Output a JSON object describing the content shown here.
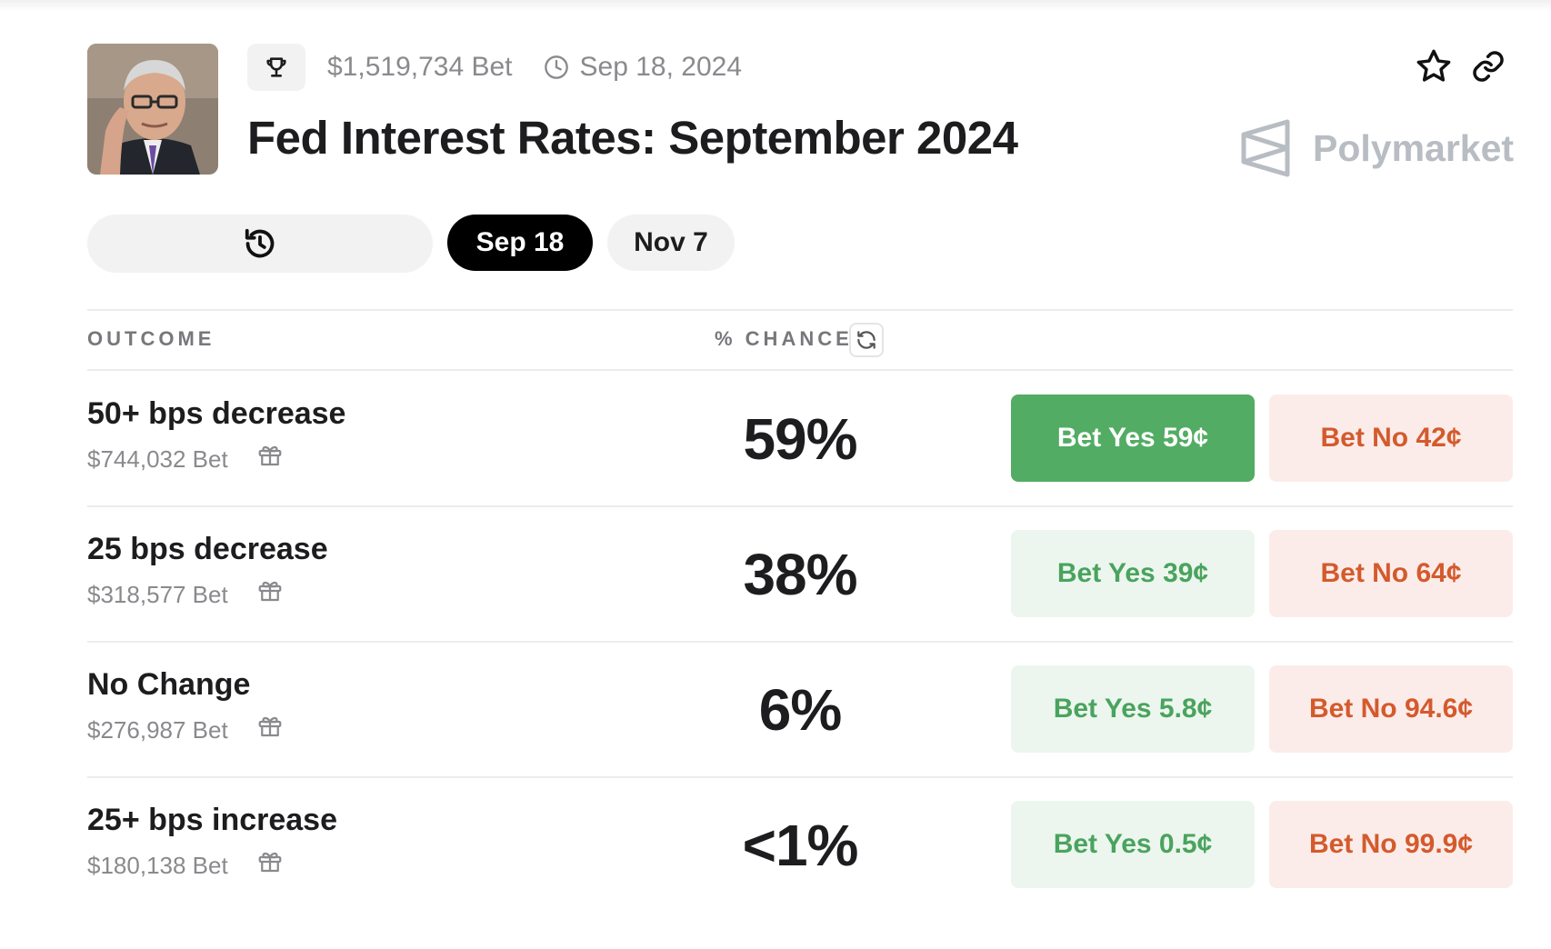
{
  "header": {
    "volume": "$1,519,734 Bet",
    "date": "Sep 18, 2024",
    "title": "Fed Interest Rates: September 2024",
    "brand": "Polymarket",
    "icons": [
      "trophy-icon",
      "clock-icon",
      "star-icon",
      "link-icon",
      "polymarket-logo-icon"
    ]
  },
  "date_tabs": {
    "history_icon": "history-icon",
    "tabs": [
      {
        "label": "Sep 18",
        "active": true
      },
      {
        "label": "Nov 7",
        "active": false
      }
    ]
  },
  "table": {
    "col_outcome": "OUTCOME",
    "col_chance": "% CHANCE",
    "rows": [
      {
        "name": "50+ bps decrease",
        "volume": "$744,032 Bet",
        "chance": "59%",
        "yes": "Bet Yes 59¢",
        "no": "Bet No 42¢",
        "yes_active": true
      },
      {
        "name": "25 bps decrease",
        "volume": "$318,577 Bet",
        "chance": "38%",
        "yes": "Bet Yes 39¢",
        "no": "Bet No 64¢",
        "yes_active": false
      },
      {
        "name": "No Change",
        "volume": "$276,987 Bet",
        "chance": "6%",
        "yes": "Bet Yes 5.8¢",
        "no": "Bet No 94.6¢",
        "yes_active": false
      },
      {
        "name": "25+ bps increase",
        "volume": "$180,138 Bet",
        "chance": "<1%",
        "yes": "Bet Yes 0.5¢",
        "no": "Bet No 99.9¢",
        "yes_active": false
      }
    ]
  },
  "colors": {
    "yes_active_bg": "#52ac63",
    "yes_bg": "#ecf6ee",
    "yes_text": "#4aa35e",
    "no_bg": "#fbecea",
    "no_text": "#d45a2c",
    "active_tab_bg": "#000000"
  }
}
